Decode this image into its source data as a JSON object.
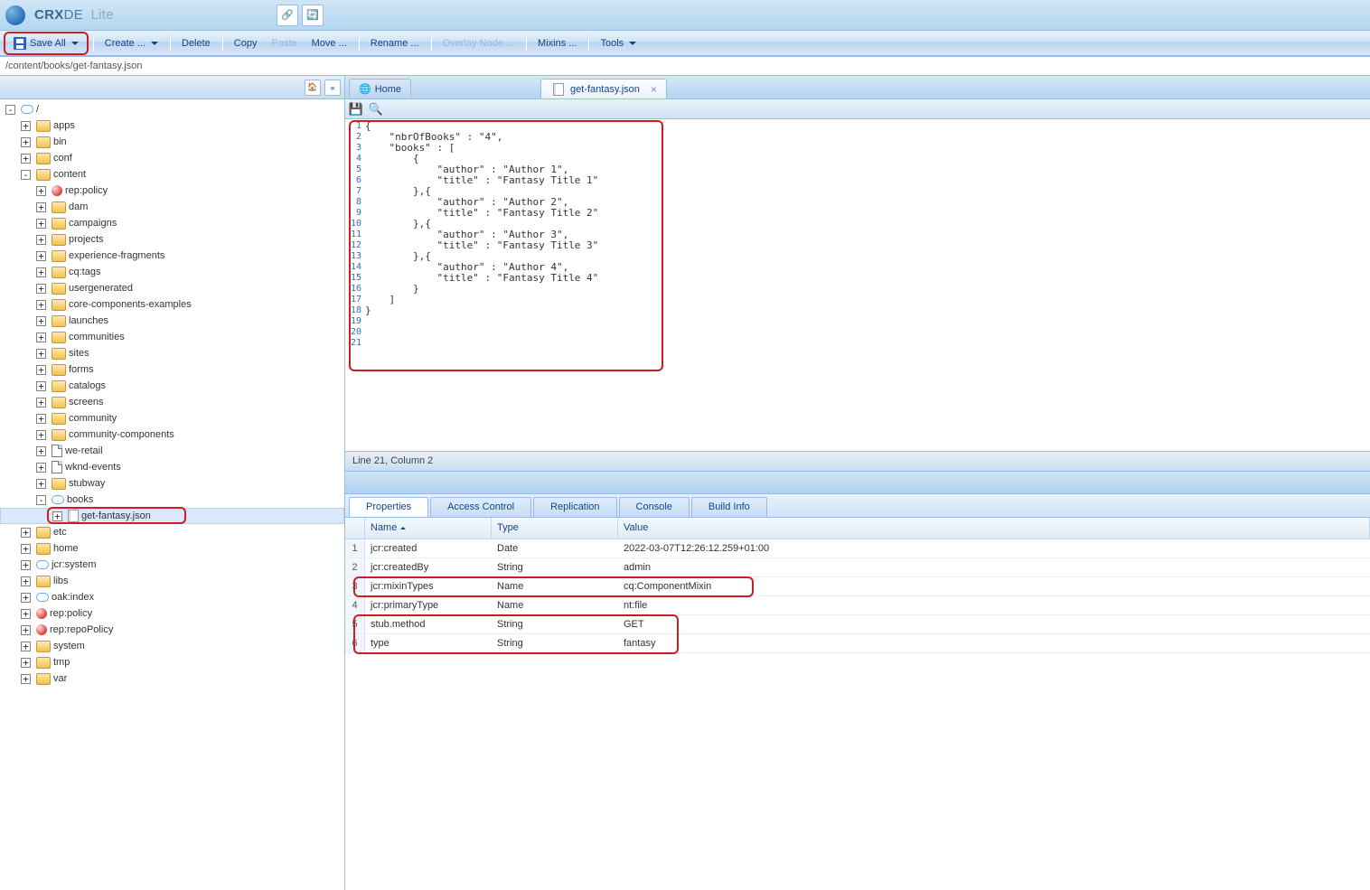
{
  "app": {
    "brand_pre": "CRX",
    "brand_post": "DE",
    "brand_lite": "Lite"
  },
  "toolbar": {
    "save_all": "Save All",
    "create": "Create ...",
    "delete": "Delete",
    "copy": "Copy",
    "paste": "Paste",
    "move": "Move ...",
    "rename": "Rename ...",
    "overlay": "Overlay Node ...",
    "mixins": "Mixins ...",
    "tools": "Tools"
  },
  "path": "/content/books/get-fantasy.json",
  "tree": {
    "root": "/",
    "apps": "apps",
    "bin": "bin",
    "conf": "conf",
    "content": "content",
    "content_children": {
      "rep_policy": "rep:policy",
      "dam": "dam",
      "campaigns": "campaigns",
      "projects": "projects",
      "experience_fragments": "experience-fragments",
      "cq_tags": "cq:tags",
      "usergenerated": "usergenerated",
      "core_components_examples": "core-components-examples",
      "launches": "launches",
      "communities": "communities",
      "sites": "sites",
      "forms": "forms",
      "catalogs": "catalogs",
      "screens": "screens",
      "community": "community",
      "community_components": "community-components",
      "we_retail": "we-retail",
      "wknd_events": "wknd-events",
      "stubway": "stubway",
      "books": "books",
      "get_fantasy": "get-fantasy.json"
    },
    "etc": "etc",
    "home": "home",
    "jcr_system": "jcr:system",
    "libs": "libs",
    "oak_index": "oak:index",
    "rep_policy_root": "rep:policy",
    "rep_repo_policy": "rep:repoPolicy",
    "system": "system",
    "tmp": "tmp",
    "var": "var"
  },
  "tabs": {
    "home": "Home",
    "file": "get-fantasy.json"
  },
  "code": {
    "lines": [
      "{",
      "    \"nbrOfBooks\" : \"4\",",
      "    \"books\" : [",
      "        {",
      "            \"author\" : \"Author 1\",",
      "            \"title\" : \"Fantasy Title 1\"",
      "        },{",
      "            \"author\" : \"Author 2\",",
      "            \"title\" : \"Fantasy Title 2\"",
      "        },{",
      "            \"author\" : \"Author 3\",",
      "            \"title\" : \"Fantasy Title 3\"",
      "        },{",
      "            \"author\" : \"Author 4\",",
      "            \"title\" : \"Fantasy Title 4\"",
      "        }",
      "    ]",
      "}"
    ]
  },
  "status": "Line 21, Column 2",
  "bottom_tabs": {
    "properties": "Properties",
    "access_control": "Access Control",
    "replication": "Replication",
    "console": "Console",
    "build_info": "Build Info"
  },
  "grid_headers": {
    "name": "Name",
    "type": "Type",
    "value": "Value"
  },
  "properties": [
    {
      "idx": "1",
      "name": "jcr:created",
      "type": "Date",
      "value": "2022-03-07T12:26:12.259+01:00"
    },
    {
      "idx": "2",
      "name": "jcr:createdBy",
      "type": "String",
      "value": "admin"
    },
    {
      "idx": "3",
      "name": "jcr:mixinTypes",
      "type": "Name",
      "value": "cq:ComponentMixin"
    },
    {
      "idx": "4",
      "name": "jcr:primaryType",
      "type": "Name",
      "value": "nt:file"
    },
    {
      "idx": "5",
      "name": "stub.method",
      "type": "String",
      "value": "GET"
    },
    {
      "idx": "6",
      "name": "type",
      "type": "String",
      "value": "fantasy"
    }
  ]
}
